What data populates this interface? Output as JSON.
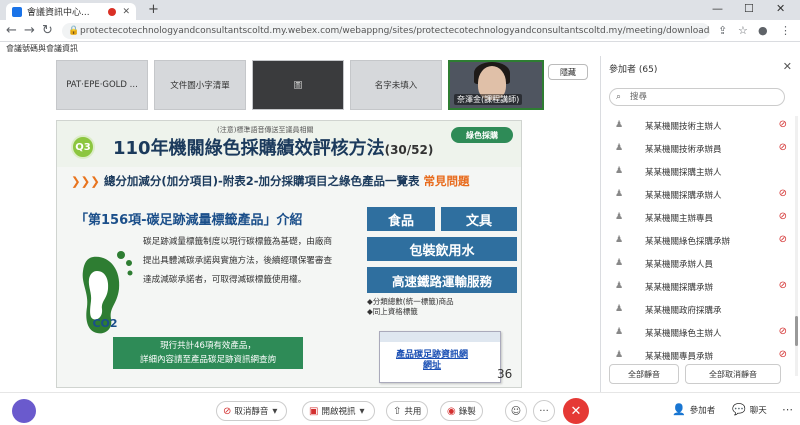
{
  "browser": {
    "tab_title": "會議資訊中心...",
    "tab_close": "✕",
    "new_tab": "+",
    "url": "protectecotechnologyandconsultantscoltd.my.webex.com/webappng/sites/protectecotechnologyandconsultantscoltd.my/meeting/download/4f440644cb40437...",
    "win_min": "—",
    "win_max": "☐",
    "win_close": "✕"
  },
  "meta": {
    "text": "會議號碼與會議資訊"
  },
  "thumbnails": [
    {
      "label": "PAT·EPE·GOLD\n...",
      "style": "light"
    },
    {
      "label": "文件圖小字清單",
      "style": "light"
    },
    {
      "label": "圖",
      "style": "dark"
    },
    {
      "label": "名字未填入",
      "style": "light"
    },
    {
      "label": "奈澤金(課程講師)",
      "style": "video"
    }
  ],
  "toggle_button": "隱藏",
  "slide": {
    "badge": "Q3",
    "title": "110年機關綠色採購績效評核方法",
    "title_num": "(30/52)",
    "overlay": "(注意)標準語音傳送至議員相關",
    "logo": "綠色採購",
    "subtitle_arrows": "❯❯❯",
    "subtitle": "總分加減分(加分項目)-附表2-加分採購項目之綠色產品一覽表",
    "subtitle_faq": "常見問題",
    "section_head": "「第156項-碳足跡減量標籤產品」介紹",
    "tags": [
      "食品",
      "文具",
      "包裝飲用水",
      "高速鐵路運輸服務"
    ],
    "footprint_label": "CO2",
    "description": "碳足跡減量標籤制度以現行碳標籤為基礎，由廠商提出具體減碳承諾與實施方法，後續經環保署審查達成減碳承諾者，可取得減碳標籤使用權。",
    "bullets": [
      "◆分類總數(統一標籤)商品",
      "◆同上資格標籤"
    ],
    "green_box": "現行共計46項有效產品，\n詳細內容請至產品碳足跡資訊網查詢",
    "shot_link": "產品碳足跡資訊網\n網址",
    "page_number": "36"
  },
  "panel": {
    "title": "參加者 (65)",
    "close": "✕",
    "search_placeholder": "搜尋",
    "participants": [
      {
        "name": "某某機關技術主辦人",
        "muted": true
      },
      {
        "name": "某某機關技術承辦員",
        "muted": true
      },
      {
        "name": "某某機關採購主辦人",
        "muted": false
      },
      {
        "name": "某某機關採購承辦人",
        "muted": true
      },
      {
        "name": "某某機關主辦專員",
        "muted": true
      },
      {
        "name": "某某機關綠色採購承辦",
        "muted": true
      },
      {
        "name": "某某機關承辦人員",
        "muted": false
      },
      {
        "name": "某某機關採購承辦",
        "muted": true
      },
      {
        "name": "某某機關政府採購承",
        "muted": false
      },
      {
        "name": "某某機關綠色主辦人",
        "muted": true
      },
      {
        "name": "某某機關專員承辦",
        "muted": true
      }
    ],
    "mute_all": "全部靜音",
    "unmute_all": "全部取消靜音"
  },
  "bottombar": {
    "mute_label": "取消靜音",
    "video_label": "開啟視訊",
    "share_label": "共用",
    "record_label": "錄製",
    "more": "···",
    "end": "✕",
    "participants_label": "參加者",
    "chat_label": "聊天"
  },
  "colors": {
    "accent": "#1b3a5c",
    "tag_blue": "#2f6f9f",
    "green": "#2e8b57",
    "orange": "#e86b1c",
    "end_red": "#e53935"
  }
}
